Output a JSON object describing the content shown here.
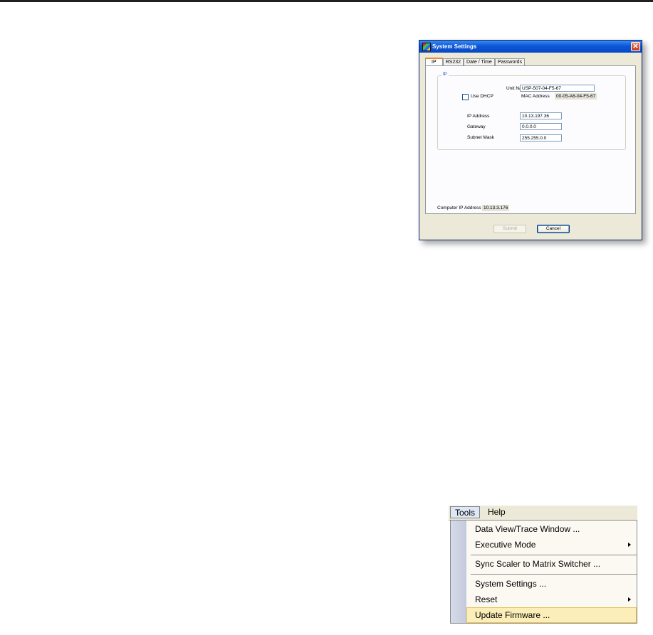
{
  "dialog": {
    "title": "System Settings",
    "close_glyph": "✕",
    "tabs": [
      {
        "label": "IP",
        "active": true
      },
      {
        "label": "RS232",
        "active": false
      },
      {
        "label": "Date / Time",
        "active": false
      },
      {
        "label": "Passwords",
        "active": false
      }
    ],
    "ip_group": {
      "legend": "IP",
      "unit_name_label": "Unit Name",
      "unit_name_value": "USP-507-04-F5-67",
      "use_dhcp_label": "Use DHCP",
      "use_dhcp_checked": false,
      "mac_label": "MAC Address",
      "mac_value": "00-05-A6-04-F5-67",
      "ip_address_label": "IP Address",
      "ip_address_value": "10.13.197.36",
      "gateway_label": "Gateway",
      "gateway_value": "0.0.0.0",
      "subnet_mask_label": "Subnet Mask",
      "subnet_mask_value": "255.255.0.0"
    },
    "computer_ip_label": "Computer IP Address",
    "computer_ip_value": "10.13.3.176",
    "submit_label": "Submit",
    "cancel_label": "Cancel"
  },
  "menu": {
    "tools_label": "Tools",
    "help_label": "Help",
    "items": [
      {
        "label": "Data View/Trace Window ...",
        "submenu": false
      },
      {
        "label": "Executive Mode",
        "submenu": true
      },
      {
        "label": "Sync Scaler to Matrix Switcher ...",
        "submenu": false
      },
      {
        "label": "System Settings ...",
        "submenu": false
      },
      {
        "label": "Reset",
        "submenu": true
      },
      {
        "label": "Update Firmware ...",
        "submenu": false,
        "highlighted": true
      }
    ]
  }
}
